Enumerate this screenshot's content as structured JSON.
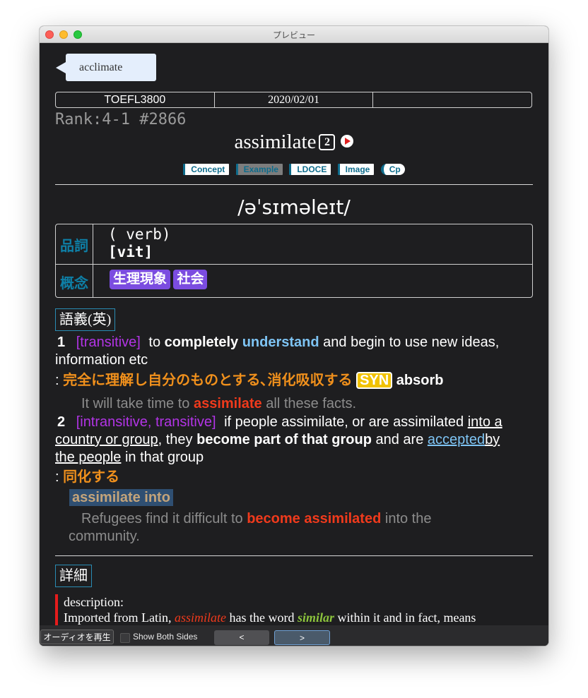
{
  "window": {
    "title": "プレビュー"
  },
  "word_tag": "acclimate",
  "info": {
    "deck": "TOEFL3800",
    "date": "2020/02/01",
    "extra": ""
  },
  "rank": "Rank:4-1 #2866",
  "headword": "assimilate",
  "headword_num": "2",
  "buttons": {
    "concept": "Concept",
    "example": "Example",
    "ldoce": "LDOCE",
    "image": "Image",
    "cp": "Cp"
  },
  "ipa": "/əˈsɪməleɪt/",
  "pos_section": {
    "label_pos": "品詞",
    "pos_line1": "( verb)",
    "pos_line2": "[vit]",
    "label_concept": "概念",
    "concepts": [
      "生理現象",
      "社会"
    ]
  },
  "meaning_header": "語義(英)",
  "sense1": {
    "num": "1",
    "gram": "[transitive]",
    "t1": "to",
    "t2": "completely",
    "t3": "understand",
    "t4": "and begin to use new ideas, information etc",
    "colon": ":",
    "ja": "完全に理解し自分のものとする､消化吸収する",
    "syn_label": "SYN",
    "syn": "absorb",
    "ex_a": "It will take time to",
    "ex_b": "assimilate",
    "ex_c": "all these facts."
  },
  "sense2": {
    "num": "2",
    "gram": "[intransitive, transitive]",
    "t1": "if people assimilate, or are assimilated",
    "t2": "into a country or group",
    "t3": ", they",
    "t4": "become part of that group",
    "t5": "and are",
    "t6": "accepted",
    "t7": "by the people",
    "t8": "in that group",
    "colon": ":",
    "ja": "同化する",
    "phrase": "assimilate into",
    "ex_a": "Refugees find it difficult to",
    "ex_b": "become assimilated",
    "ex_c": "into the community."
  },
  "detail_header": "詳細",
  "description": {
    "label": "description:",
    "a": "Imported from Latin,",
    "b": "assimilate",
    "c": "has the word",
    "d": "similar",
    "e": "within it and in fact, means"
  },
  "bottom": {
    "audio": "オーディオを再生",
    "show_both": "Show Both Sides",
    "prev": "<",
    "next": ">"
  }
}
